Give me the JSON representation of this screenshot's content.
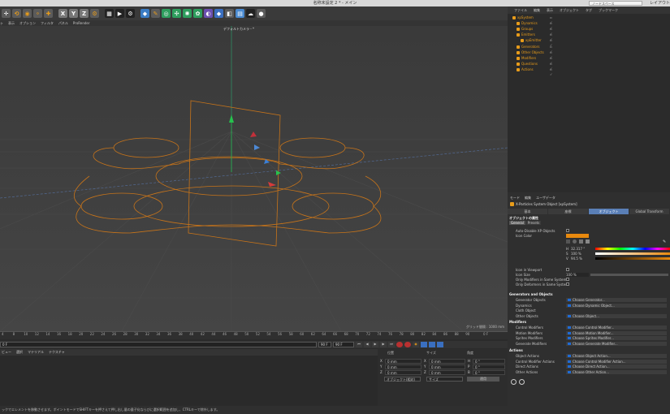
{
  "window_title": "名称未設定 2 * - メイン",
  "layout_selector": "ノードスペース",
  "layout_label": "レイアウト",
  "toolbar": {
    "icons": [
      "move-icon",
      "rotate-icon",
      "scale-icon",
      "select-icon",
      "x-axis",
      "y-axis",
      "z-axis",
      "world-icon",
      "render-icon",
      "render-view-icon",
      "render-settings-icon",
      "cube-icon",
      "pen-icon",
      "subdivision-icon",
      "array-icon",
      "xp-icon",
      "deformer-icon",
      "camera-icon",
      "light-icon",
      "floor-icon",
      "sky-icon"
    ],
    "axis_labels": [
      "X",
      "Y",
      "Z"
    ]
  },
  "viewport_menu": [
    "ヶ",
    "表示",
    "オプション",
    "フィルタ",
    "パネル",
    "ProRender"
  ],
  "viewport": {
    "camera_label": "デフォルトカメラ・*",
    "grid_info": "グリッド間隔 : 1000 mm"
  },
  "timeline": {
    "ticks": [
      "4",
      "8",
      "10",
      "12",
      "14",
      "16",
      "18",
      "20",
      "22",
      "24",
      "26",
      "28",
      "30",
      "32",
      "34",
      "36",
      "38",
      "40",
      "42",
      "44",
      "46",
      "48",
      "50",
      "52",
      "54",
      "56",
      "58",
      "60",
      "62",
      "64",
      "66",
      "68",
      "70",
      "72",
      "74",
      "76",
      "78",
      "80",
      "82",
      "84",
      "86",
      "88",
      "90"
    ],
    "end_label": "0 F"
  },
  "transport": {
    "current_frame": "0 F",
    "start_frame": "90 F",
    "end_frame": "90 F"
  },
  "material_menu": [
    "ビュー",
    "選択",
    "マテリアル",
    "テクスチャ"
  ],
  "coord_panel": {
    "headers": [
      "位置",
      "サイズ",
      "角度"
    ],
    "rows": [
      {
        "axis": "X",
        "pos": "0 mm",
        "size_axis": "X",
        "size": "0 mm",
        "rot_axis": "H",
        "rot": "0 °"
      },
      {
        "axis": "Y",
        "pos": "0 mm",
        "size_axis": "Y",
        "size": "0 mm",
        "rot_axis": "P",
        "rot": "0 °"
      },
      {
        "axis": "Z",
        "pos": "0 mm",
        "size_axis": "Z",
        "size": "0 mm",
        "rot_axis": "B",
        "rot": "0 °"
      }
    ],
    "mode_select": "オブジェクト(相対)",
    "size_select": "サイズ",
    "apply_label": "適用"
  },
  "status_text": "ックでエレメントを移動させます。ポイントモードでSHIFTキーを押さえて押し出し量の量子化ならびに選択範囲を追加し、CTRLキーで除外します。",
  "object_manager": {
    "menu": [
      "ファイル",
      "編集",
      "表示",
      "オブジェクト",
      "タグ",
      "ブックマーク"
    ],
    "items": [
      {
        "label": "xpSystem",
        "color": "#e89c1a"
      },
      {
        "label": "Dynamics",
        "color": "#e89c1a"
      },
      {
        "label": "Groups",
        "color": "#e89c1a"
      },
      {
        "label": "Emitters",
        "color": "#e89c1a"
      },
      {
        "label": "xpEmitter",
        "color": "#e89c1a"
      },
      {
        "label": "Generators",
        "color": "#e89c1a"
      },
      {
        "label": "Other Objects",
        "color": "#e89c1a"
      },
      {
        "label": "Modifiers",
        "color": "#e89c1a"
      },
      {
        "label": "Questions",
        "color": "#e89c1a"
      },
      {
        "label": "Actions",
        "color": "#e89c1a"
      }
    ]
  },
  "attributes": {
    "menu": [
      "モード",
      "編集",
      "ユーザデータ"
    ],
    "object_title": "X-Particles System Object [xpSystem]",
    "tabs": [
      "基本",
      "座標",
      "オブジェクト",
      "Global Transform"
    ],
    "active_tab": "オブジェクト",
    "section_title": "オブジェクトの属性",
    "subtabs": [
      "General",
      "Presets"
    ],
    "general": {
      "auto_disable": "Auto-Disable XP Objects",
      "icon_color": "Icon Color",
      "h_label": "H",
      "h_value": "32.317 °",
      "s_label": "S",
      "s_value": "100 %",
      "v_label": "V",
      "v_value": "94.5 %",
      "icon_in_viewport": "Icon in Viewport",
      "icon_size": "Icon Size",
      "icon_size_value": "100 %",
      "only_modifiers": "Only Modifiers in Same System",
      "only_deformers": "Only Deformers in Same System"
    },
    "generators": {
      "title": "Generators and Objects",
      "rows": [
        {
          "label": "Generator Objects",
          "button": "Choose Generator..."
        },
        {
          "label": "Dynamics",
          "button": "Choose Dynamic Object..."
        },
        {
          "label": "Cloth Object",
          "button": ""
        },
        {
          "label": "Other Objects",
          "button": "Choose Object..."
        }
      ]
    },
    "modifiers": {
      "title": "Modifiers",
      "rows": [
        {
          "label": "Control Modifiers",
          "button": "Choose Control Modifier..."
        },
        {
          "label": "Motion Modifiers",
          "button": "Choose Motion Modifier..."
        },
        {
          "label": "Sprites Modifiers",
          "button": "Choose Sprites Modifier..."
        },
        {
          "label": "Generate Modifiers",
          "button": "Choose Generate Modifier..."
        }
      ]
    },
    "actions": {
      "title": "Actions",
      "rows": [
        {
          "label": "Object Actions",
          "button": "Choose Object Action..."
        },
        {
          "label": "Control Modifier Actions",
          "button": "Choose Control Modifier Action..."
        },
        {
          "label": "Direct Actions",
          "button": "Choose Direct Action..."
        },
        {
          "label": "Other Actions",
          "button": "Choose Other Action..."
        }
      ]
    },
    "accent_color": "#e8890e"
  }
}
